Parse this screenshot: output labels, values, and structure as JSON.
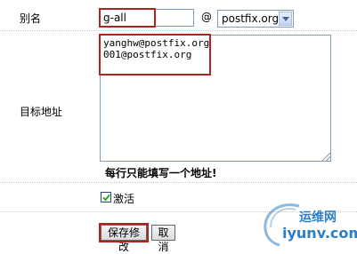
{
  "alias": {
    "label": "别名",
    "value": "g-all",
    "at": "@",
    "domain": "postfix.org"
  },
  "target": {
    "label": "目标地址",
    "value": "yanghw@postfix.org\n001@postfix.org",
    "hint": "每行只能填写一个地址!"
  },
  "activate": {
    "label": "激活",
    "checked": true
  },
  "buttons": {
    "save": "保存修改",
    "cancel": "取消"
  },
  "watermark": {
    "name": "运维网",
    "site": "iyunv.com"
  },
  "colors": {
    "highlight": "#b0231f",
    "border": "#7f9db9",
    "watermark": "#2b7fc5"
  }
}
